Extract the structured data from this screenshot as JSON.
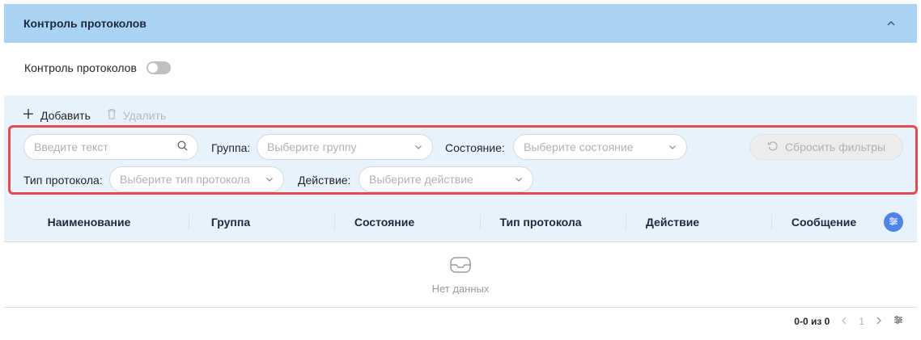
{
  "panel": {
    "title": "Контроль протоколов",
    "background": "#a9d3f4"
  },
  "toggle": {
    "label": "Контроль протоколов",
    "enabled": false
  },
  "actions": {
    "add_label": "Добавить",
    "delete_label": "Удалить"
  },
  "filters": {
    "search_placeholder": "Введите текст",
    "group": {
      "label": "Группа",
      "placeholder": "Выберите группу"
    },
    "state": {
      "label": "Состояние",
      "placeholder": "Выберите состояние"
    },
    "protocol_type": {
      "label": "Тип протокола",
      "placeholder": "Выберите тип протокола"
    },
    "action": {
      "label": "Действие",
      "placeholder": "Выберите действие"
    },
    "reset_label": "Сбросить фильтры",
    "highlight_color": "#e5484d"
  },
  "table": {
    "columns": [
      "Наименование",
      "Группа",
      "Состояние",
      "Тип протокола",
      "Действие",
      "Сообщение"
    ],
    "empty_text": "Нет данных"
  },
  "pagination": {
    "range": "0-0 из 0",
    "page": "1"
  },
  "colors": {
    "accent": "#4f83e6",
    "header_bg": "#e7f2fc"
  }
}
